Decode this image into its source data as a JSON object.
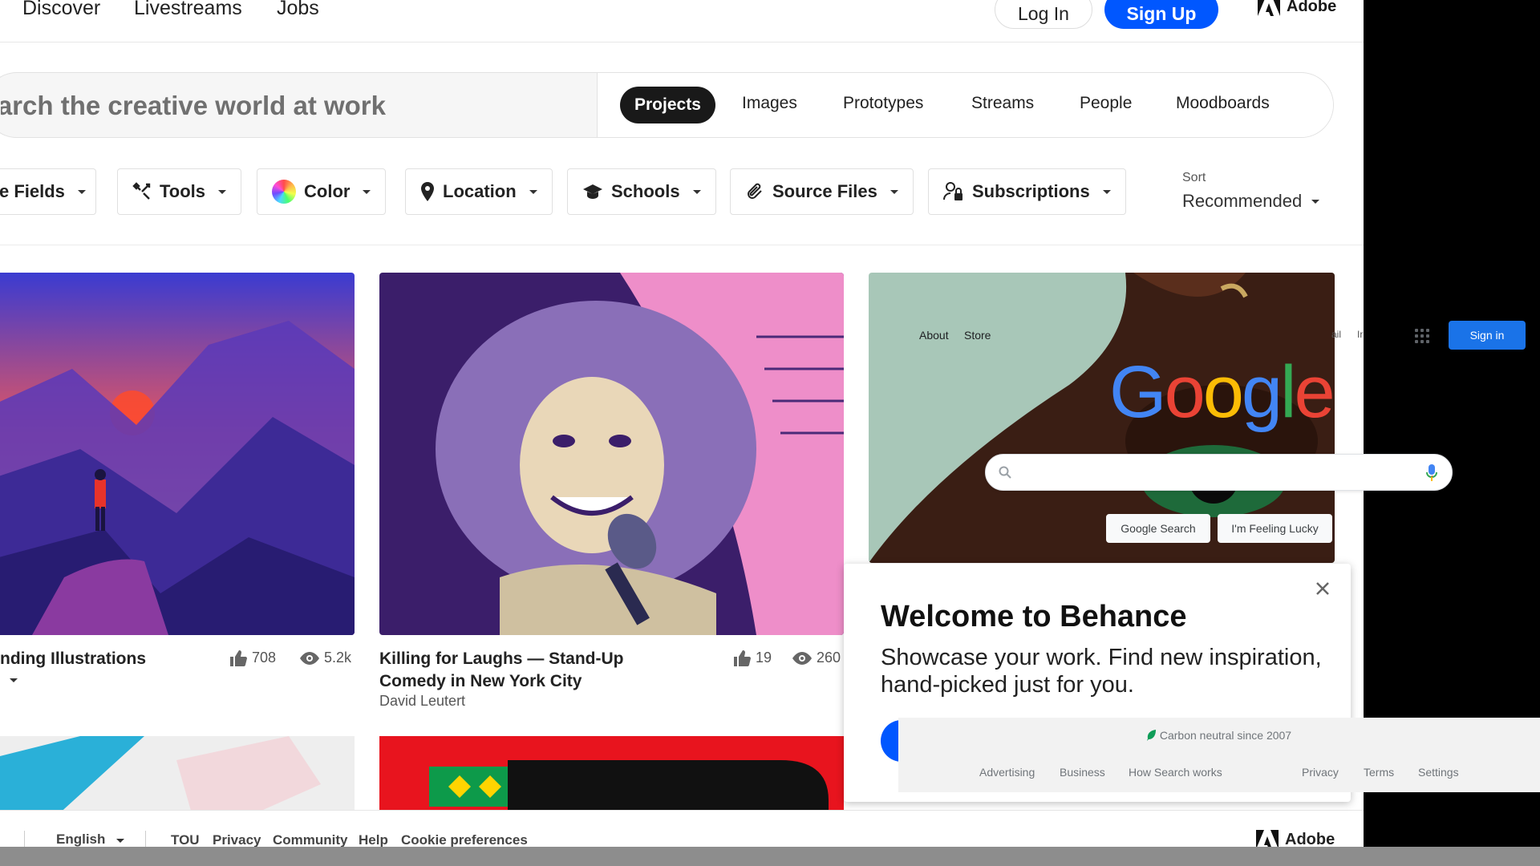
{
  "behance": {
    "nav": {
      "discover": "Discover",
      "livestreams": "Livestreams",
      "jobs": "Jobs"
    },
    "auth": {
      "login": "Log In",
      "signup": "Sign Up"
    },
    "adobe_label": "Adobe",
    "search": {
      "placeholder_visible": "arch the creative world at work",
      "tabs": [
        "Projects",
        "Images",
        "Prototypes",
        "Streams",
        "People",
        "Moodboards"
      ],
      "active_tab": "Projects"
    },
    "filters": {
      "creative_fields": "e Fields",
      "tools": "Tools",
      "color": "Color",
      "location": "Location",
      "schools": "Schools",
      "source_files": "Source Files",
      "subscriptions": "Subscriptions"
    },
    "sort": {
      "label": "Sort",
      "value": "Recommended"
    },
    "cards": [
      {
        "title": "nding Illustrations",
        "likes": "708",
        "views": "5.2k"
      },
      {
        "title_line1": "Killing for Laughs — Stand-Up",
        "title_line2": "Comedy in New York City",
        "author": "David Leutert",
        "likes": "19",
        "views": "260"
      }
    ],
    "footer": {
      "language": "English",
      "links": [
        "TOU",
        "Privacy",
        "Community",
        "Help",
        "Cookie preferences"
      ]
    },
    "welcome": {
      "title": "Welcome to Behance",
      "subtitle": "Showcase your work. Find new inspiration, hand-picked just for you."
    }
  },
  "google": {
    "nav": {
      "about": "About",
      "store": "Store",
      "gmail_fragment": "ail",
      "images_fragment": "Ir"
    },
    "signin": "Sign in",
    "logo_letters": [
      "G",
      "o",
      "o",
      "g",
      "l",
      "e"
    ],
    "logo_colors": [
      "#4285f4",
      "#ea4335",
      "#fbbc05",
      "#4285f4",
      "#34a853",
      "#ea4335"
    ],
    "buttons": {
      "search": "Google Search",
      "lucky": "I'm Feeling Lucky"
    },
    "footer": {
      "carbon": "Carbon neutral since 2007",
      "links": [
        "Advertising",
        "Business",
        "How Search works",
        "Privacy",
        "Terms",
        "Settings"
      ]
    }
  },
  "colors": {
    "behance_blue": "#0057ff",
    "google_blue": "#1a73e8"
  }
}
